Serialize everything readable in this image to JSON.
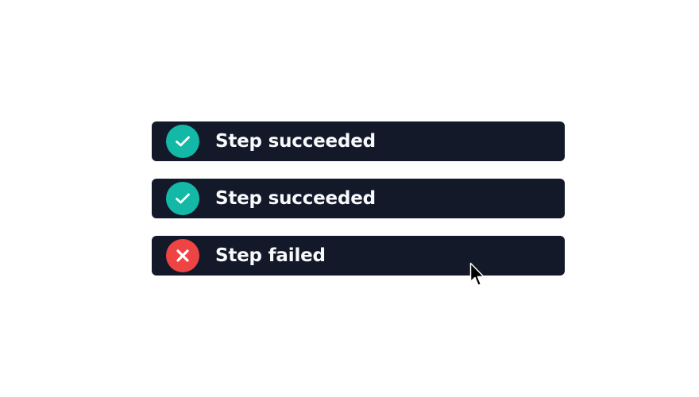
{
  "steps": [
    {
      "label": "Step succeeded",
      "status": "success",
      "icon": "check-icon",
      "color": "#14b8a6"
    },
    {
      "label": "Step succeeded",
      "status": "success",
      "icon": "check-icon",
      "color": "#14b8a6"
    },
    {
      "label": "Step failed",
      "status": "error",
      "icon": "x-icon",
      "color": "#ef4444"
    }
  ],
  "theme": {
    "row_background": "#131929",
    "text_color": "#f8fafc",
    "page_background": "#ffffff"
  },
  "cursor": {
    "icon": "mouse-pointer-icon"
  }
}
